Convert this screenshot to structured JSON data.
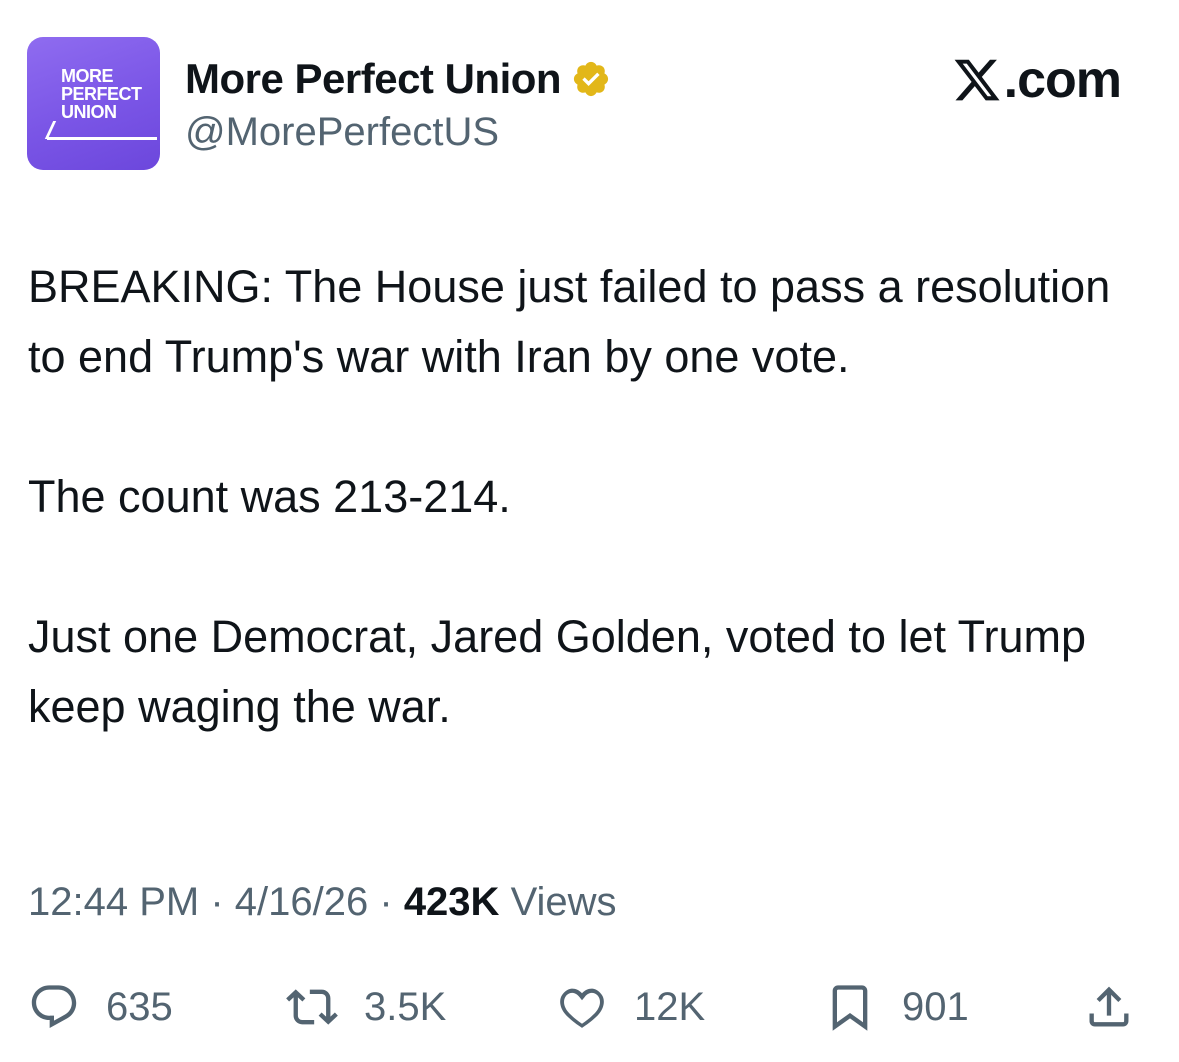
{
  "account": {
    "avatar_text": [
      "MORE",
      "PERFECT",
      "UNION"
    ],
    "display_name": "More Perfect Union",
    "handle": "@MorePerfectUS",
    "verified_icon": "verified-badge-icon"
  },
  "brand": {
    "label": ".com",
    "icon": "x-logo-icon"
  },
  "post": {
    "paragraphs": [
      "BREAKING: The House just failed to pass a resolution to end Trump's war with Iran by one vote.",
      "The count was 213-214.",
      "Just one Democrat, Jared Golden, voted to let Trump keep waging the war."
    ]
  },
  "meta": {
    "time": "12:44 PM",
    "separator": "·",
    "date": "4/16/26",
    "views_count": "423K",
    "views_label": "Views"
  },
  "actions": {
    "replies": "635",
    "reposts": "3.5K",
    "likes": "12K",
    "bookmarks": "901"
  },
  "colors": {
    "text": "#0f1419",
    "secondary": "#536471",
    "verified_gold": "#e2b719",
    "avatar_purple": "#7a55e6"
  }
}
